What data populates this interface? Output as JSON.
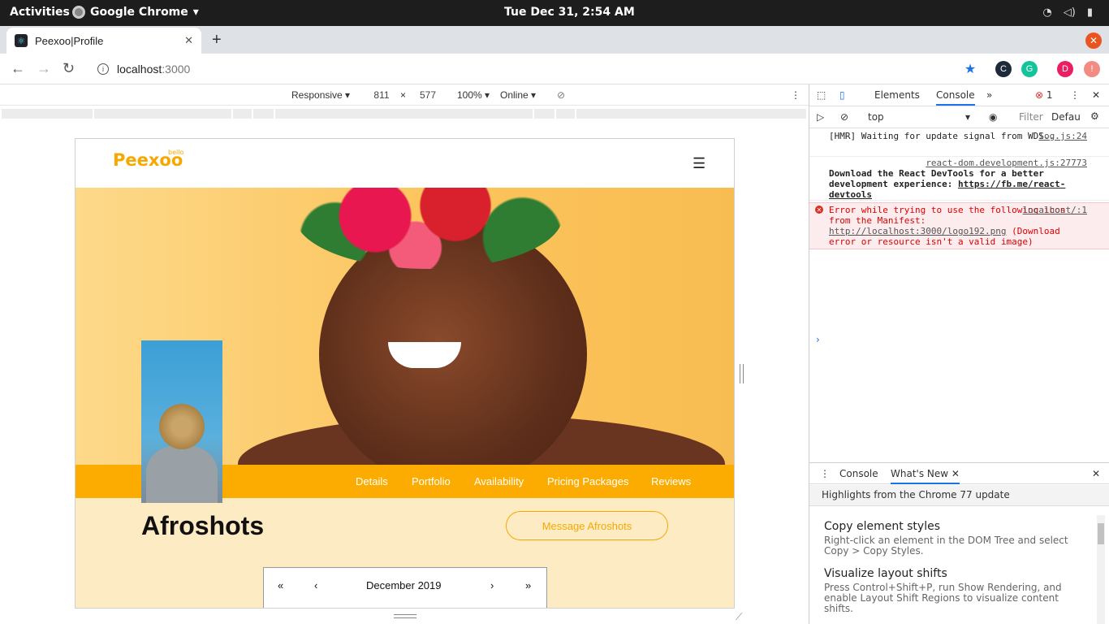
{
  "system": {
    "activities": "Activities",
    "app_name": "Google Chrome",
    "clock": "Tue Dec 31,  2:54 AM"
  },
  "browser": {
    "tab_title": "Peexoo|Profile",
    "url_host": "localhost",
    "url_port": ":3000",
    "extension_avatar": "D"
  },
  "device_toolbar": {
    "mode": "Responsive",
    "width": "811",
    "times": "×",
    "height": "577",
    "zoom": "100%",
    "network": "Online"
  },
  "site": {
    "logo": "Peexoo",
    "logo_small": "bello",
    "nav": [
      "Details",
      "Portfolio",
      "Availability",
      "Pricing Packages",
      "Reviews"
    ],
    "profile_name": "Afroshots",
    "message_button": "Message Afroshots",
    "calendar": {
      "first": "«",
      "prev": "‹",
      "month": "December 2019",
      "next": "›",
      "last": "»"
    }
  },
  "devtools": {
    "tabs": [
      "Elements",
      "Console"
    ],
    "error_count": "1",
    "context": "top",
    "filter_placeholder": "Filter",
    "levels": "Defau",
    "messages": [
      {
        "text": "[HMR] Waiting for update signal from WDS...",
        "source": "log.js:24"
      },
      {
        "text_bold": "Download the React DevTools for a better development experience: ",
        "link": "https://fb.me/react-devtools",
        "source": "react-dom.development.js:27773"
      },
      {
        "text": "Error while trying to use the following icon from the Manifest: ",
        "link": "http://localhost:3000/logo192.png",
        "text_after": " (Download error or resource isn't a valid image)",
        "source": "localhost/:1"
      }
    ],
    "drawer_tabs": [
      "Console",
      "What's New"
    ],
    "whatsnew_heading": "Highlights from the Chrome 77 update",
    "whatsnew_items": [
      {
        "title": "Copy element styles",
        "desc": "Right-click an element in the DOM Tree and select Copy > Copy Styles."
      },
      {
        "title": "Visualize layout shifts",
        "desc": "Press Control+Shift+P, run Show Rendering, and enable Layout Shift Regions to visualize content shifts."
      }
    ]
  },
  "colors": {
    "brand": "#f5a900",
    "nav_strip": "#fcac00",
    "profile_bg": "#fdebc4",
    "error": "#d93025",
    "devtools_accent": "#1a73e8"
  }
}
